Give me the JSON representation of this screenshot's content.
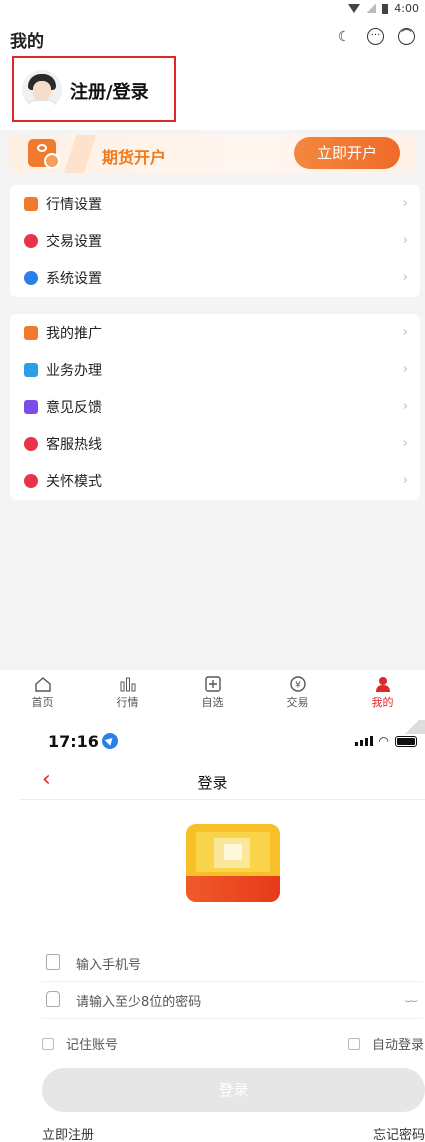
{
  "status_bar": {
    "time": "4:00"
  },
  "header": {
    "title": "我的",
    "icons": [
      "moon-icon",
      "message-icon",
      "service-icon"
    ]
  },
  "user": {
    "login_label": "注册/登录"
  },
  "banner": {
    "text": "期货开户",
    "button": "立即开户"
  },
  "menu_group1": [
    {
      "label": "行情设置",
      "icon": "chart-icon",
      "color": "#f07a2e"
    },
    {
      "label": "交易设置",
      "icon": "yen-icon",
      "color": "#e8334a"
    },
    {
      "label": "系统设置",
      "icon": "gear-icon",
      "color": "#2b7fe8"
    }
  ],
  "menu_group2": [
    {
      "label": "我的推广",
      "icon": "grid-icon",
      "color": "#f07a2e"
    },
    {
      "label": "业务办理",
      "icon": "briefcase-icon",
      "color": "#2a9ee8"
    },
    {
      "label": "意见反馈",
      "icon": "feedback-icon",
      "color": "#7b4ee8"
    },
    {
      "label": "客服热线",
      "icon": "phone-icon",
      "color": "#e8334a"
    },
    {
      "label": "关怀模式",
      "icon": "heart-icon",
      "color": "#e8334a"
    }
  ],
  "tabbar": [
    {
      "label": "首页",
      "icon": "home-icon"
    },
    {
      "label": "行情",
      "icon": "bars-icon"
    },
    {
      "label": "自选",
      "icon": "add-icon"
    },
    {
      "label": "交易",
      "icon": "yen-circle-icon"
    },
    {
      "label": "我的",
      "icon": "person-icon",
      "active": true
    }
  ],
  "login_screen": {
    "time": "17:16",
    "title": "登录",
    "phone_placeholder": "输入手机号",
    "password_placeholder": "请输入至少8位的密码",
    "remember": "记住账号",
    "auto_login": "自动登录",
    "login_button": "登录",
    "register": "立即注册",
    "forgot": "忘记密码"
  },
  "colors": {
    "accent": "#e02828",
    "orange": "#f07a2e"
  }
}
